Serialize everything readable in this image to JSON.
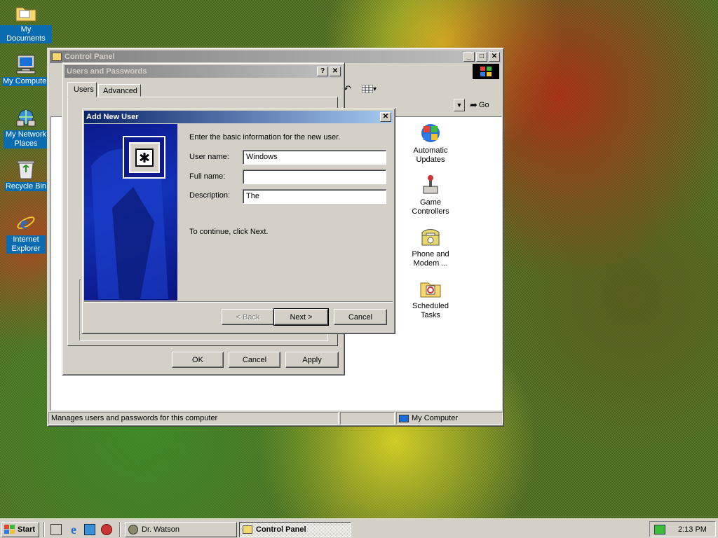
{
  "desktop": {
    "icons": [
      {
        "label": "My Documents",
        "icon": "folder-documents-icon"
      },
      {
        "label": "My Computer",
        "icon": "computer-icon"
      },
      {
        "label": "My Network Places",
        "icon": "network-icon"
      },
      {
        "label": "Recycle Bin",
        "icon": "recycle-bin-icon"
      },
      {
        "label": "Internet Explorer",
        "icon": "internet-explorer-icon"
      }
    ]
  },
  "control_panel": {
    "title": "Control Panel",
    "address_go": "Go",
    "items": [
      {
        "label": "Automatic Updates",
        "icon": "automatic-updates-icon"
      },
      {
        "label": "Game Controllers",
        "icon": "game-controllers-icon"
      },
      {
        "label": "Phone and Modem ...",
        "icon": "phone-modem-icon"
      },
      {
        "label": "Scheduled Tasks",
        "icon": "scheduled-tasks-icon"
      }
    ],
    "status_left": "Manages users and passwords for this computer",
    "status_right": "My Computer"
  },
  "users_passwords": {
    "title": "Users and Passwords",
    "tabs": [
      "Users",
      "Advanced"
    ],
    "buttons": {
      "ok": "OK",
      "cancel": "Cancel",
      "apply": "Apply"
    }
  },
  "add_user": {
    "title": "Add New User",
    "intro": "Enter the basic information for the new user.",
    "fields": {
      "username_label": "User name:",
      "username_value": "Windows",
      "fullname_label": "Full name:",
      "fullname_value": "",
      "description_label": "Description:",
      "description_value": "The"
    },
    "continue_text": "To continue, click Next.",
    "buttons": {
      "back": "< Back",
      "next": "Next >",
      "cancel": "Cancel"
    }
  },
  "taskbar": {
    "start": "Start",
    "tasks": [
      {
        "label": "Dr. Watson",
        "pressed": false
      },
      {
        "label": "Control Panel",
        "pressed": true
      }
    ],
    "clock": "2:13 PM"
  }
}
